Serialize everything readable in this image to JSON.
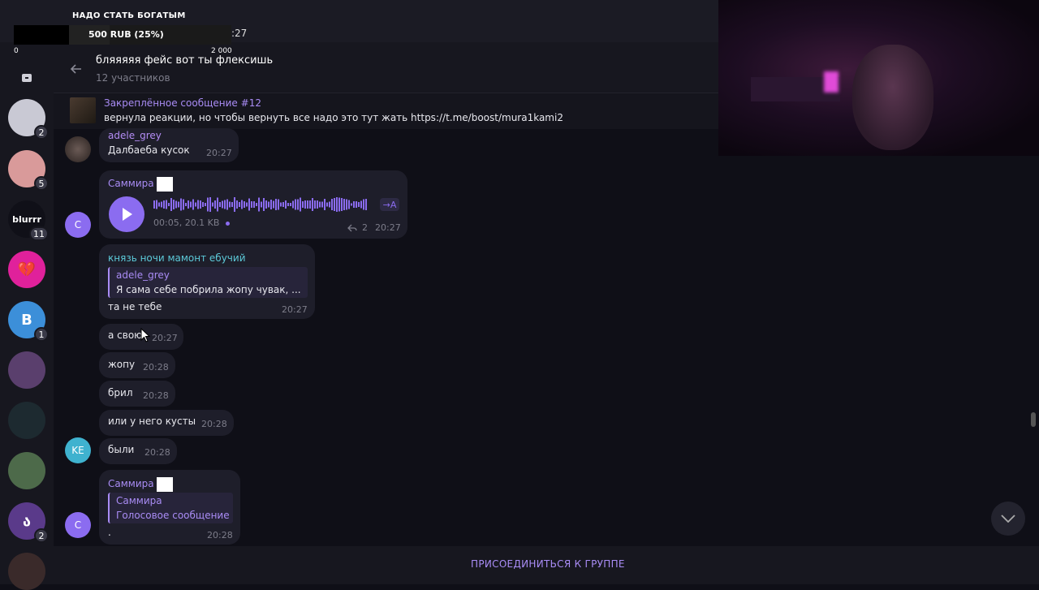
{
  "overlay": {
    "goal_title": "НАДО СТАТЬ БОГАТЫМ",
    "progress_text": "500 RUB (25%)",
    "progress_fraction": 0.25,
    "min_label": "0",
    "max_label": "2 000",
    "time_fragment": ":27"
  },
  "sidebar": {
    "items": [
      {
        "name": "chat-1",
        "badge": "2",
        "color": "#c9c9d4",
        "letter": ""
      },
      {
        "name": "chat-2",
        "badge": "5",
        "color": "#d99a9a",
        "letter": ""
      },
      {
        "name": "chat-3",
        "badge": "11",
        "color": "#101018",
        "letter": "blurrr"
      },
      {
        "name": "chat-4",
        "badge": "",
        "color": "#e0219b",
        "letter": "💔"
      },
      {
        "name": "chat-5",
        "badge": "1",
        "color": "#3c8fd9",
        "letter": "B"
      },
      {
        "name": "chat-6",
        "badge": "",
        "color": "#5a3f6d",
        "letter": ""
      },
      {
        "name": "chat-7",
        "badge": "",
        "color": "#1d2a30",
        "letter": ""
      },
      {
        "name": "chat-8",
        "badge": "",
        "color": "#4d6a4a",
        "letter": ""
      },
      {
        "name": "chat-9",
        "badge": "2",
        "color": "#5a3a8a",
        "letter": "ა"
      },
      {
        "name": "chat-10",
        "badge": "",
        "color": "#3a2a2a",
        "letter": ""
      }
    ]
  },
  "header": {
    "title": "бляяяяя фейс вот ты флексишь",
    "subtitle": "12 участников"
  },
  "pinned": {
    "title": "Закреплённое сообщение #12",
    "text": "вернула реакции, но чтобы вернуть все надо это тут жать https://t.me/boost/mura1kami2"
  },
  "messages": {
    "m1": {
      "sender": "adele_grey",
      "text": "Далбаеба кусок",
      "time": "20:27"
    },
    "m2": {
      "sender": "Саммира",
      "duration": "00:05, 20.1 KB",
      "transcribe": "→A",
      "replies": "2",
      "time": "20:27",
      "avatar": "С"
    },
    "m3": {
      "sender": "князь ночи мамонт ебучий",
      "reply_name": "adele_grey",
      "reply_text": "Я сама себе побрила жопу чувак, ...",
      "text": "та не тебе",
      "time": "20:27"
    },
    "m4": {
      "text": "а свою",
      "time": "20:27"
    },
    "m5": {
      "text": "жопу",
      "time": "20:28"
    },
    "m6": {
      "text": "брил",
      "time": "20:28"
    },
    "m7": {
      "text": "или у него кусты",
      "time": "20:28"
    },
    "m8": {
      "text": "были",
      "time": "20:28",
      "avatar": "KE"
    },
    "m9": {
      "sender": "Саммира",
      "reply_name": "Саммира",
      "reply_text": "Голосовое сообщение",
      "text": ".",
      "time": "20:28",
      "avatar": "С"
    }
  },
  "footer": {
    "join_label": "ПРИСОЕДИНИТЬСЯ К ГРУППЕ"
  },
  "colors": {
    "accent": "#a98cf5",
    "bubble": "#1e1e2a",
    "background": "#0f0f17"
  }
}
